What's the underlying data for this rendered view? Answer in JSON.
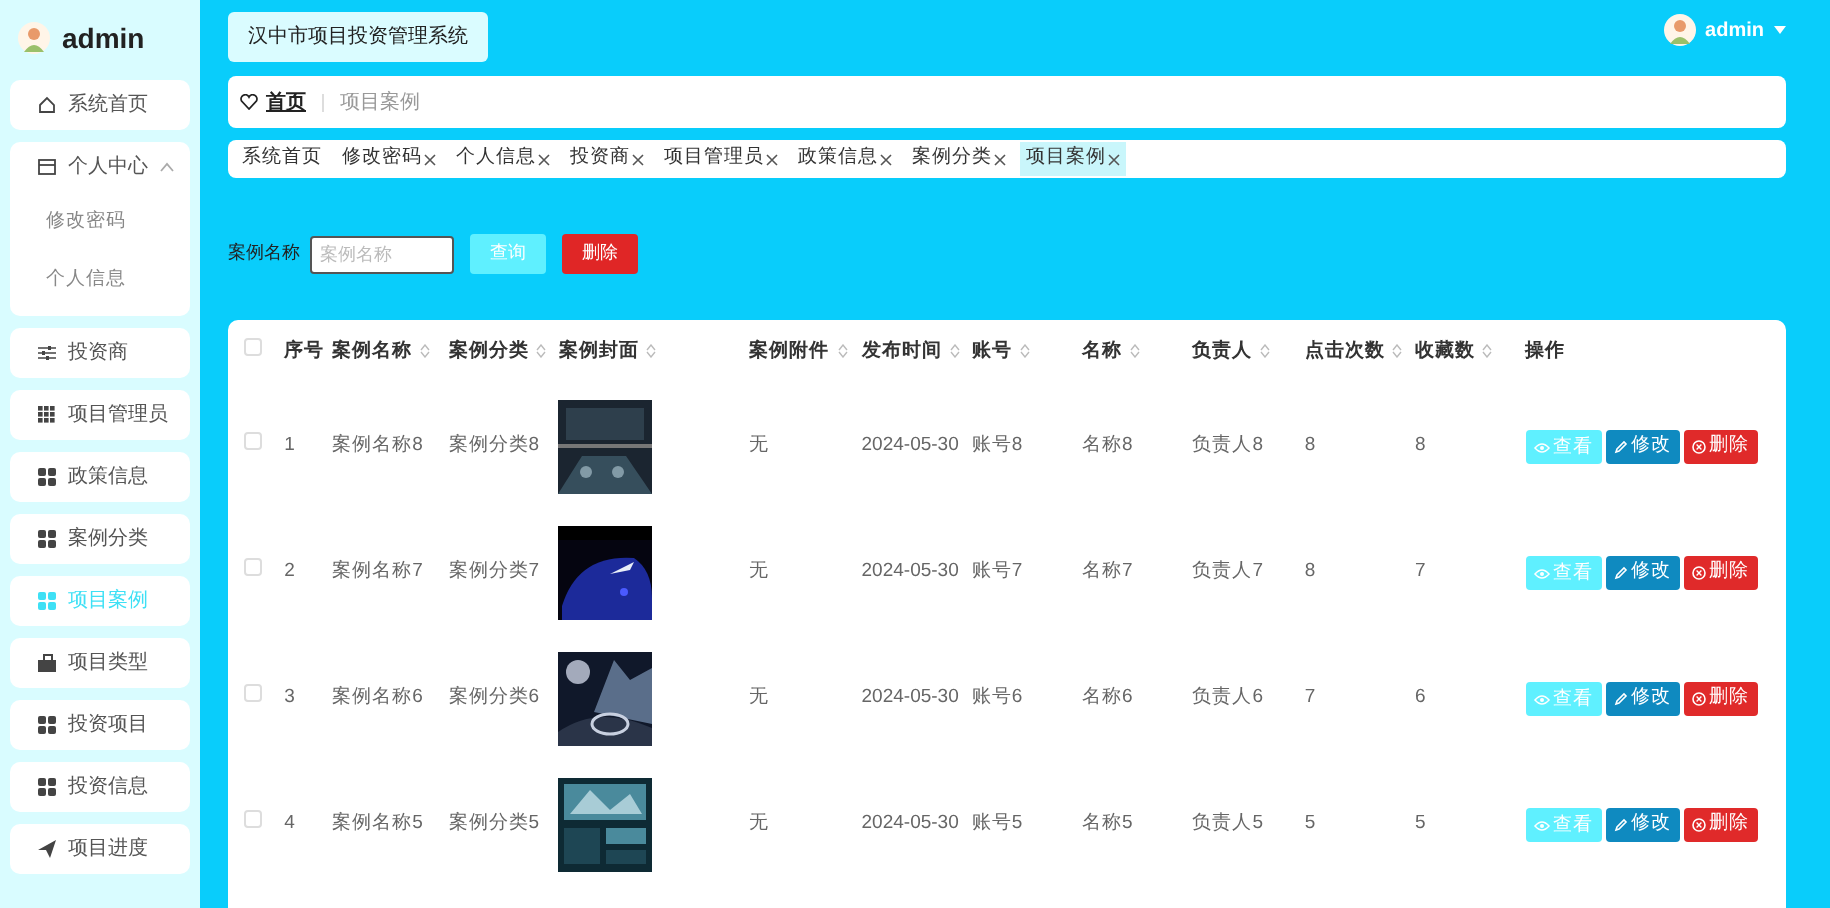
{
  "sidebar": {
    "user": "admin",
    "menu": [
      {
        "label": "系统首页",
        "kind": "home",
        "selected": false
      },
      {
        "label": "个人中心",
        "kind": "group",
        "selected": false,
        "expanded": true,
        "children": [
          {
            "label": "修改密码"
          },
          {
            "label": "个人信息"
          }
        ]
      },
      {
        "label": "投资商",
        "kind": "sliders",
        "selected": false
      },
      {
        "label": "项目管理员",
        "kind": "grid9",
        "selected": false
      },
      {
        "label": "政策信息",
        "kind": "grid4",
        "selected": false
      },
      {
        "label": "案例分类",
        "kind": "grid4",
        "selected": false
      },
      {
        "label": "项目案例",
        "kind": "grid4",
        "selected": true
      },
      {
        "label": "项目类型",
        "kind": "box",
        "selected": false
      },
      {
        "label": "投资项目",
        "kind": "grid4",
        "selected": false
      },
      {
        "label": "投资信息",
        "kind": "grid4",
        "selected": false
      },
      {
        "label": "项目进度",
        "kind": "plane",
        "selected": false
      }
    ]
  },
  "header": {
    "title": "汉中市项目投资管理系统",
    "user": "admin"
  },
  "breadcrumb": [
    "首页",
    "项目案例"
  ],
  "tabs": [
    {
      "label": "系统首页",
      "closable": false,
      "selected": false
    },
    {
      "label": "修改密码",
      "closable": true,
      "selected": false
    },
    {
      "label": "个人信息",
      "closable": true,
      "selected": false
    },
    {
      "label": "投资商",
      "closable": true,
      "selected": false
    },
    {
      "label": "项目管理员",
      "closable": true,
      "selected": false
    },
    {
      "label": "政策信息",
      "closable": true,
      "selected": false
    },
    {
      "label": "案例分类",
      "closable": true,
      "selected": false
    },
    {
      "label": "项目案例",
      "closable": true,
      "selected": true
    }
  ],
  "search": {
    "label": "案例名称",
    "placeholder": "案例名称",
    "buttons": [
      {
        "label": "查询",
        "kind": "query"
      },
      {
        "label": "删除",
        "kind": "delete"
      }
    ]
  },
  "table": {
    "select_all": false,
    "columns": [
      {
        "label": "序号",
        "sortable": false
      },
      {
        "label": "案例名称",
        "sortable": true
      },
      {
        "label": "案例分类",
        "sortable": true
      },
      {
        "label": "案例封面",
        "sortable": true
      },
      {
        "label": "案例附件",
        "sortable": true
      },
      {
        "label": "发布时间",
        "sortable": true
      },
      {
        "label": "账号",
        "sortable": true
      },
      {
        "label": "名称",
        "sortable": true
      },
      {
        "label": "负责人",
        "sortable": true
      },
      {
        "label": "点击次数",
        "sortable": true
      },
      {
        "label": "收藏数",
        "sortable": true
      },
      {
        "label": "操作",
        "sortable": false
      }
    ],
    "rows": [
      {
        "checked": false,
        "cells": [
          "1",
          "案例名称8",
          "案例分类8",
          {
            "kind": "picture"
          },
          "无",
          "2024-05-30",
          "账号8",
          "名称8",
          "负责人8",
          "8",
          "8"
        ],
        "actions": [
          {
            "label": "查看",
            "kind": "view"
          },
          {
            "label": "修改",
            "kind": "edit"
          },
          {
            "label": "删除",
            "kind": "delete"
          }
        ]
      },
      {
        "checked": false,
        "cells": [
          "2",
          "案例名称7",
          "案例分类7",
          {
            "kind": "picture"
          },
          "无",
          "2024-05-30",
          "账号7",
          "名称7",
          "负责人7",
          "8",
          "7"
        ],
        "actions": [
          {
            "label": "查看",
            "kind": "view"
          },
          {
            "label": "修改",
            "kind": "edit"
          },
          {
            "label": "删除",
            "kind": "delete"
          }
        ]
      },
      {
        "checked": false,
        "cells": [
          "3",
          "案例名称6",
          "案例分类6",
          {
            "kind": "picture"
          },
          "无",
          "2024-05-30",
          "账号6",
          "名称6",
          "负责人6",
          "7",
          "6"
        ],
        "actions": [
          {
            "label": "查看",
            "kind": "view"
          },
          {
            "label": "修改",
            "kind": "edit"
          },
          {
            "label": "删除",
            "kind": "delete"
          }
        ]
      },
      {
        "checked": false,
        "cells": [
          "4",
          "案例名称5",
          "案例分类5",
          {
            "kind": "picture"
          },
          "无",
          "2024-05-30",
          "账号5",
          "名称5",
          "负责人5",
          "5",
          "5"
        ],
        "actions": [
          {
            "label": "查看",
            "kind": "view"
          },
          {
            "label": "修改",
            "kind": "edit"
          },
          {
            "label": "删除",
            "kind": "delete"
          }
        ]
      }
    ]
  }
}
